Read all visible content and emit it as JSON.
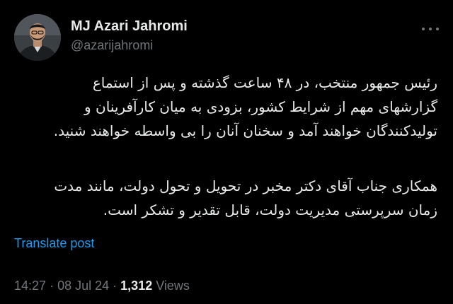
{
  "author": {
    "name": "MJ Azari Jahromi",
    "handle": "@azarijahromi"
  },
  "post": {
    "paragraphs": [
      {
        "lines": [
          "رئیس جمهور منتخب، در ۴۸ ساعت گذشته و پس از استماع",
          "گزارشهای مهم از شرایط کشور، بزودی به میان کارآفرینان و",
          "تولیدکنندگان خواهند آمد و سخنان آنان را بی واسطه خواهند شنید."
        ]
      },
      {
        "lines": [
          "همکاری جناب آقای دکتر مخبر در تحویل و تحول دولت، مانند مدت",
          "زمان سرپرستی مدیریت دولت، قابل تقدیر و تشکر است."
        ]
      }
    ],
    "translate_label": "Translate post",
    "time": "14:27",
    "date": "08 Jul 24",
    "separator": "·",
    "views_count": "1,312",
    "views_label": "Views"
  },
  "icons": {
    "more": "more-horizontal-icon",
    "avatar": "profile-photo"
  },
  "colors": {
    "background": "#000000",
    "text_primary": "#e7e9ea",
    "text_secondary": "#71767b",
    "link": "#1d9bf0"
  }
}
